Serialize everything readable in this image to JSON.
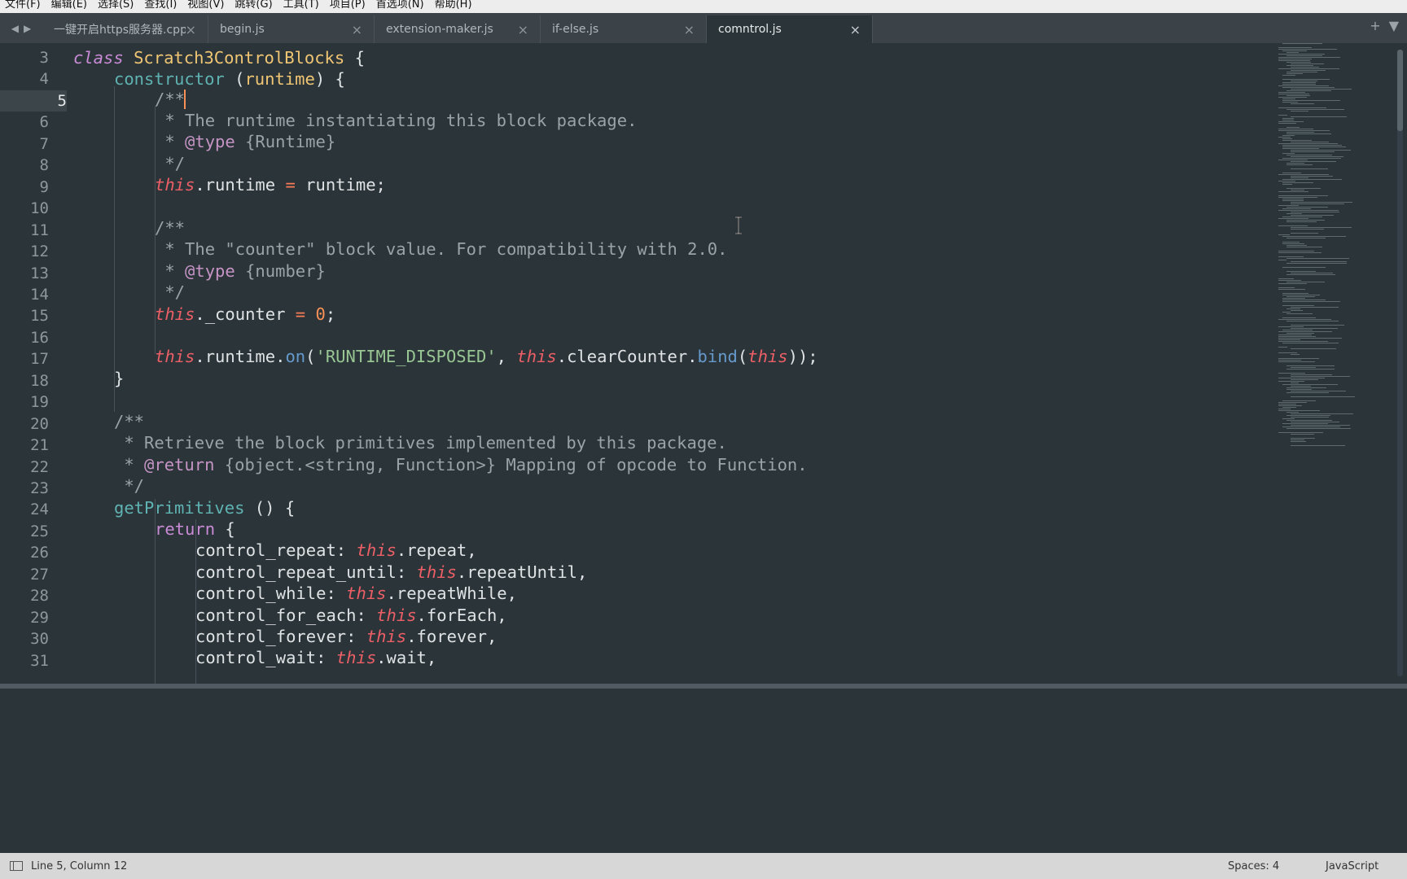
{
  "menubar": [
    "文件(F)",
    "编辑(E)",
    "选择(S)",
    "查找(I)",
    "视图(V)",
    "跳转(G)",
    "工具(T)",
    "项目(P)",
    "首选项(N)",
    "帮助(H)"
  ],
  "tabs": [
    {
      "label": "一键开启https服务器.cpp",
      "active": false
    },
    {
      "label": "begin.js",
      "active": false
    },
    {
      "label": "extension-maker.js",
      "active": false
    },
    {
      "label": "if-else.js",
      "active": false
    },
    {
      "label": "comntrol.js",
      "active": true
    }
  ],
  "editor": {
    "line_numbers": [
      "3",
      "4",
      "5",
      "6",
      "7",
      "8",
      "9",
      "10",
      "11",
      "12",
      "13",
      "14",
      "15",
      "16",
      "17",
      "18",
      "19",
      "20",
      "21",
      "22",
      "23",
      "24",
      "25",
      "26",
      "27",
      "28",
      "29",
      "30",
      "31"
    ],
    "current_line": "5",
    "code": {
      "l3_kw": "class",
      "l3_cls": "Scratch3ControlBlocks",
      "l3_rest": " {",
      "l4_fn": "constructor",
      "l4_a": " (",
      "l4_param": "runtime",
      "l4_b": ") {",
      "l5": "/**",
      "l6": " * The runtime instantiating this block package.",
      "l7_a": " * ",
      "l7_tag": "@type",
      "l7_b": " {Runtime}",
      "l8": " */",
      "l9_this": "this",
      "l9_a": ".runtime ",
      "l9_op": "=",
      "l9_b": " runtime;",
      "l11": "/**",
      "l12": " * The \"counter\" block value. For compatibility with 2.0.",
      "l13_a": " * ",
      "l13_tag": "@type",
      "l13_b": " {number}",
      "l14": " */",
      "l15_this": "this",
      "l15_a": "._counter ",
      "l15_op": "=",
      "l15_sp": " ",
      "l15_num": "0",
      "l15_b": ";",
      "l17_this": "this",
      "l17_a": ".runtime.",
      "l17_meth": "on",
      "l17_b": "(",
      "l17_str": "'RUNTIME_DISPOSED'",
      "l17_c": ", ",
      "l17_this2": "this",
      "l17_d": ".clearCounter.",
      "l17_meth2": "bind",
      "l17_e": "(",
      "l17_this3": "this",
      "l17_f": "));",
      "l18": "}",
      "l20": "/**",
      "l21": " * Retrieve the block primitives implemented by this package.",
      "l22_a": " * ",
      "l22_tag": "@return",
      "l22_b": " {object.<string, Function>} Mapping of opcode to Function.",
      "l23": " */",
      "l24_fn": "getPrimitives",
      "l24_b": " () {",
      "l25_kw": "return",
      "l25_b": " {",
      "l26_a": "control_repeat: ",
      "l26_this": "this",
      "l26_b": ".repeat,",
      "l27_a": "control_repeat_until: ",
      "l27_this": "this",
      "l27_b": ".repeatUntil,",
      "l28_a": "control_while: ",
      "l28_this": "this",
      "l28_b": ".repeatWhile,",
      "l29_a": "control_for_each: ",
      "l29_this": "this",
      "l29_b": ".forEach,",
      "l30_a": "control_forever: ",
      "l30_this": "this",
      "l30_b": ".forever,",
      "l31_a": "control_wait: ",
      "l31_this": "this",
      "l31_b": ".wait,"
    }
  },
  "status": {
    "position": "Line 5, Column 12",
    "spaces": "Spaces: 4",
    "syntax": "JavaScript"
  },
  "colors": {
    "background": "#2b3438",
    "keyword": "#c98bd6",
    "this": "#ec5f67",
    "string": "#99c794",
    "number": "#f99157",
    "function": "#5fb3b3",
    "class": "#f0c674"
  }
}
